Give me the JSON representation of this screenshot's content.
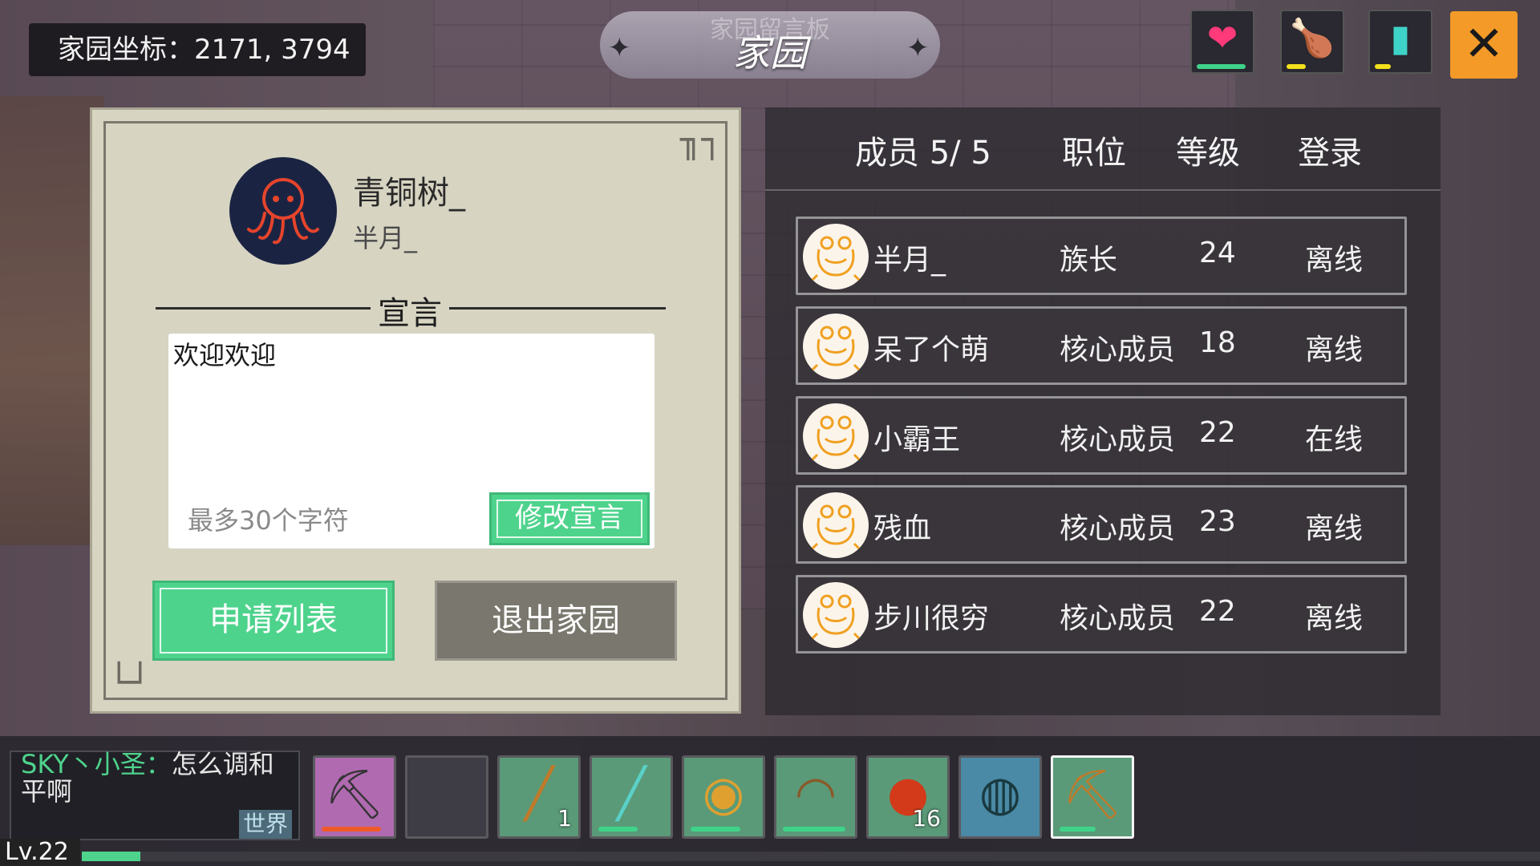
{
  "hud": {
    "coords_label": "家园坐标：2171, 3794",
    "title_sub": "家园留言板",
    "title_main": "家园",
    "status_bars": [
      {
        "name": "health",
        "icon": "heart-icon",
        "fill": 0.9,
        "color": "#3fd38a"
      },
      {
        "name": "hunger",
        "icon": "meat-icon",
        "fill": 0.35,
        "color": "#f2e21c"
      },
      {
        "name": "thirst",
        "icon": "water-icon",
        "fill": 0.3,
        "color": "#f2e21c"
      }
    ],
    "close_symbol": "✕"
  },
  "home": {
    "leader_name": "青铜树_",
    "leader_subname": "半月_",
    "declaration_title": "宣言",
    "declaration_text": "欢迎欢迎",
    "declaration_hint": "最多30个字符",
    "edit_button": "修改宣言",
    "apply_list_button": "申请列表",
    "leave_button": "退出家园"
  },
  "members": {
    "headers": [
      "成员 5/ 5",
      "职位",
      "等级",
      "登录"
    ],
    "rows": [
      {
        "name": "半月_",
        "role": "族长",
        "level": "24",
        "status": "离线"
      },
      {
        "name": "呆了个萌",
        "role": "核心成员",
        "level": "18",
        "status": "离线"
      },
      {
        "name": "小霸王",
        "role": "核心成员",
        "level": "22",
        "status": "在线"
      },
      {
        "name": "残血",
        "role": "核心成员",
        "level": "23",
        "status": "离线"
      },
      {
        "name": "步川很穷",
        "role": "核心成员",
        "level": "22",
        "status": "离线"
      }
    ]
  },
  "chat": {
    "sender": "SKY丶小圣",
    "separator": "：",
    "message": "怎么调和平啊",
    "channel": "世界"
  },
  "player": {
    "level_label": "Lv.22",
    "xp_fill": 0.04
  },
  "hotbar": [
    {
      "icon": "pickaxe-icon",
      "bg": "#b06ab0",
      "durability": 0.9,
      "bar_color": "#f05a2a",
      "count": ""
    },
    {
      "icon": "empty-slot",
      "bg": "#3e3c44",
      "durability": 0,
      "bar_color": "#000",
      "count": ""
    },
    {
      "icon": "spear-icon",
      "bg": "#5a9a78",
      "durability": 0,
      "bar_color": "#3fd38a",
      "count": "1"
    },
    {
      "icon": "crystal-spear-icon",
      "bg": "#5a9a78",
      "durability": 0.6,
      "bar_color": "#3fd38a",
      "count": ""
    },
    {
      "icon": "gourd-icon",
      "bg": "#5a9a78",
      "durability": 0.75,
      "bar_color": "#3fd38a",
      "count": ""
    },
    {
      "icon": "bow-icon",
      "bg": "#5a9a78",
      "durability": 0.95,
      "bar_color": "#3fd38a",
      "count": ""
    },
    {
      "icon": "meat-chunk-icon",
      "bg": "#5a9a78",
      "durability": 0,
      "bar_color": "#3fd38a",
      "count": "16"
    },
    {
      "icon": "orb-icon",
      "bg": "#4a8aa6",
      "durability": 0,
      "bar_color": "#3fd38a",
      "count": ""
    },
    {
      "icon": "copper-pickaxe-icon",
      "bg": "#5a9a78",
      "durability": 0.55,
      "bar_color": "#3fd38a",
      "count": ""
    }
  ]
}
